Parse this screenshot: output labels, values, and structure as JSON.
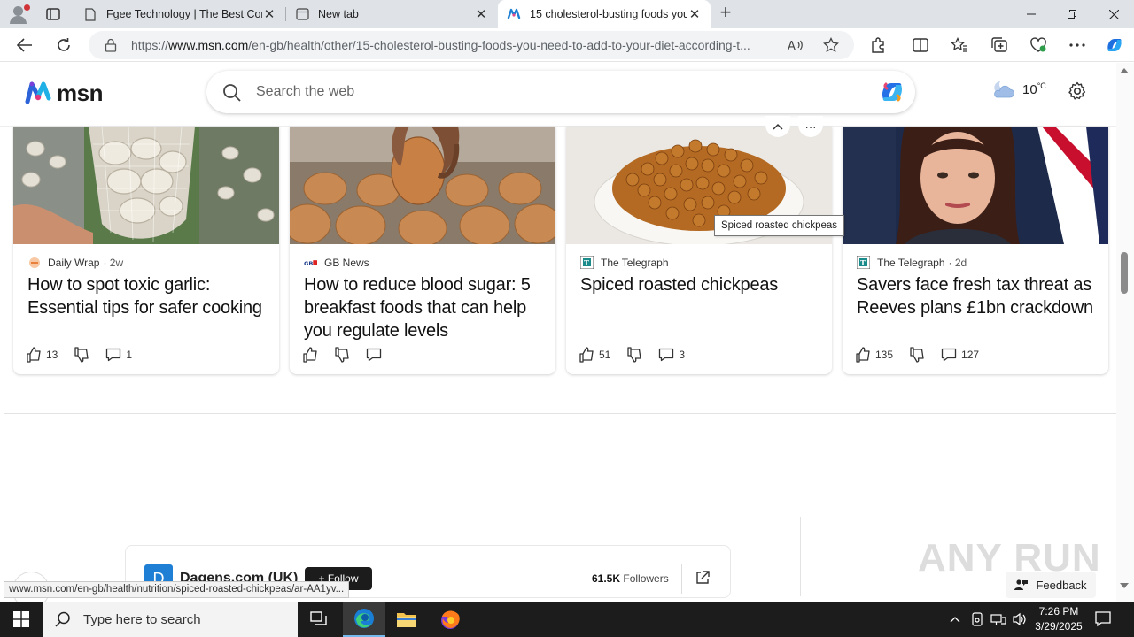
{
  "browser": {
    "tabs": [
      {
        "title": "Fgee Technology | The Best Com",
        "icon": "page-icon"
      },
      {
        "title": "New tab",
        "icon": "newtab-icon"
      },
      {
        "title": "15 cholesterol-busting foods you",
        "icon": "msn-icon",
        "active": true
      }
    ],
    "url_prefix": "https://",
    "url_domain": "www.msn.com",
    "url_path": "/en-gb/health/other/15-cholesterol-busting-foods-you-need-to-add-to-your-diet-according-t..."
  },
  "msn": {
    "logo_text": "msn",
    "search_placeholder": "Search the web",
    "weather_temp": "10",
    "weather_unit": "°C"
  },
  "cards": [
    {
      "source": "Daily Wrap",
      "age": "· 2w",
      "headline": "How to spot toxic garlic: Essential tips for safer cooking",
      "likes": "13",
      "comments": "1"
    },
    {
      "source": "GB News",
      "age": "",
      "headline": "How to reduce blood sugar: 5 breakfast foods that can help you regulate levels",
      "likes": "",
      "comments": ""
    },
    {
      "source": "The Telegraph",
      "age": "",
      "headline": "Spiced roasted chickpeas",
      "likes": "51",
      "comments": "3"
    },
    {
      "source": "The Telegraph",
      "age": "· 2d",
      "headline": "Savers face fresh tax threat as Reeves plans £1bn crackdown",
      "likes": "135",
      "comments": "127"
    }
  ],
  "tooltip": "Spiced roasted chickpeas",
  "publisher": {
    "logo_letter": "D",
    "name": "Dagens.com (UK)",
    "follow_label": "+ Follow",
    "followers_count": "61.5K",
    "followers_label": "Followers"
  },
  "status_url": "www.msn.com/en-gb/health/nutrition/spiced-roasted-chickpeas/ar-AA1yv...",
  "feedback_label": "Feedback",
  "watermark": "ANY RUN",
  "taskbar": {
    "search_placeholder": "Type here to search",
    "time": "7:26 PM",
    "date": "3/29/2025"
  },
  "colors": {
    "accent": "#1e7fd4",
    "taskbar": "#1c1c1c"
  }
}
